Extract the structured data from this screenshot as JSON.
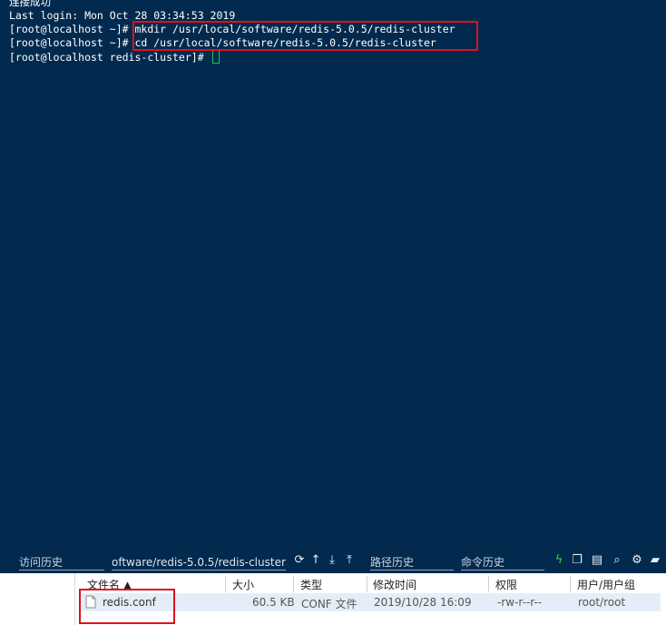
{
  "terminal": {
    "lines": [
      "连接成功",
      "Last login: Mon Oct 28 03:34:53 2019",
      "[root@localhost ~]# mkdir /usr/local/software/redis-5.0.5/redis-cluster",
      "[root@localhost ~]# cd /usr/local/software/redis-5.0.5/redis-cluster",
      "[root@localhost redis-cluster]# "
    ]
  },
  "toolbar": {
    "history_label": "访问历史",
    "path_value": "oftware/redis-5.0.5/redis-cluster",
    "path_history_label": "路径历史",
    "command_history_label": "命令历史",
    "icons": [
      "refresh-icon",
      "up-arrow-icon",
      "download-icon",
      "upload-icon",
      "lightning-icon",
      "copy-icon",
      "paste-icon",
      "search-icon",
      "gear-icon",
      "folder-open-icon"
    ]
  },
  "file_table": {
    "columns": [
      "文件名 ▲",
      "大小",
      "类型",
      "修改时间",
      "权限",
      "用户/用户组"
    ],
    "rows": [
      {
        "name": "redis.conf",
        "size": "60.5 KB",
        "type": "CONF 文件",
        "modified": "2019/10/28 16:09",
        "permissions": "-rw-r--r--",
        "owner": "root/root"
      }
    ]
  },
  "colors": {
    "terminal_bg": "#022a4e",
    "highlight": "#e0101c",
    "selected_row": "#e5eef8"
  }
}
